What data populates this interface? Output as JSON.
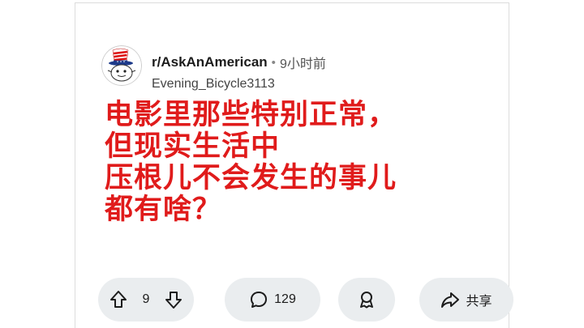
{
  "post": {
    "subreddit": "r/AskAnAmerican",
    "separator": "•",
    "time": "9小时前",
    "username": "Evening_Bicycle3113",
    "title_lines": [
      "电影里那些特别正常，",
      "但现实生活中",
      "压根儿不会发生的事儿",
      "都有啥？"
    ]
  },
  "actions": {
    "upvote_icon": "arrow-up-icon",
    "vote_count": "9",
    "downvote_icon": "arrow-down-icon",
    "comment_icon": "speech-bubble-icon",
    "comment_count": "129",
    "award_icon": "award-icon",
    "share_icon": "share-arrow-icon",
    "share_label": "共享"
  },
  "colors": {
    "title": "#e01b1b",
    "pill_bg": "#eaedef",
    "text": "#1c1c1c"
  }
}
